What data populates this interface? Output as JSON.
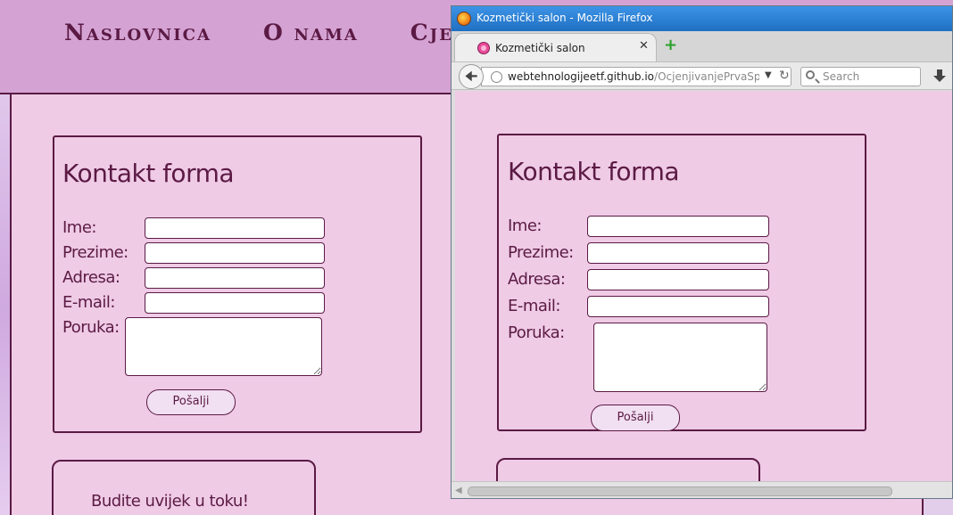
{
  "background_page": {
    "nav": [
      "Naslovnica",
      "O nama",
      "Cjenovnik"
    ],
    "contact_form": {
      "title": "Kontakt forma",
      "fields": [
        {
          "label": "Ime:",
          "value": ""
        },
        {
          "label": "Prezime:",
          "value": ""
        },
        {
          "label": "Adresa:",
          "value": ""
        },
        {
          "label": "E-mail:",
          "value": ""
        }
      ],
      "message_label": "Poruka:",
      "message_value": "",
      "submit_label": "Pošalji"
    },
    "second_card_text": "Budite uvijek u toku!"
  },
  "firefox": {
    "window_title": "Kozmetički salon - Mozilla Firefox",
    "tab_title": "Kozmetički salon",
    "tab_close": "✕",
    "new_tab": "+",
    "url_host": "webtehnologijeetf.github.io",
    "url_path": "/OcjenjivanjePrvaSpirala/",
    "search_placeholder": "Search",
    "page": {
      "title": "Kontakt forma",
      "fields": [
        {
          "label": "Ime:",
          "value": ""
        },
        {
          "label": "Prezime:",
          "value": ""
        },
        {
          "label": "Adresa:",
          "value": ""
        },
        {
          "label": "E-mail:",
          "value": ""
        }
      ],
      "message_label": "Poruka:",
      "message_value": "",
      "submit_label": "Pošalji"
    }
  },
  "colors": {
    "accent": "#5b1a44",
    "page_bg": "#efcbe6",
    "header_bg": "#d4a3d3",
    "titlebar": "#2a7fd4"
  }
}
